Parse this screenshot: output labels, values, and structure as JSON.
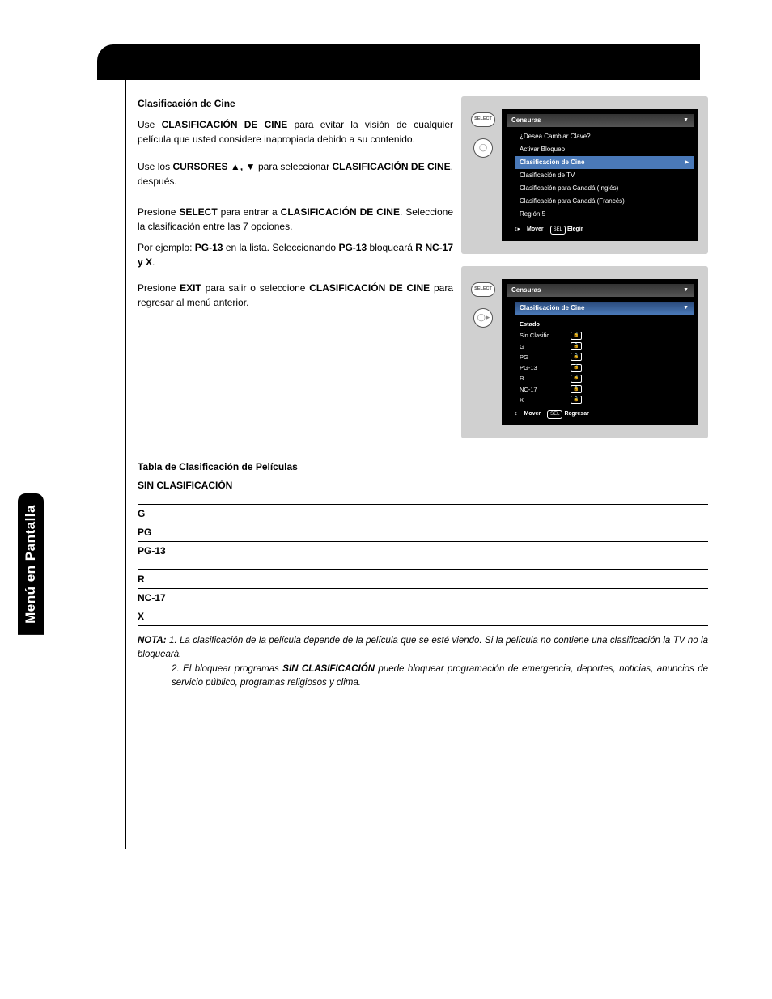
{
  "sideTab": "Menú en Pantalla",
  "heading": "Clasificación de Cine",
  "intro": {
    "pre": "Use ",
    "bold1": "CLASIFICACIÓN DE CINE",
    "post1": " para evitar la visión de cualquier película que usted considere inapropiada debido a su contenido."
  },
  "step1": {
    "pre": "Use los ",
    "cursors": "CURSORES",
    "arrows": " ▲, ▼ ",
    "mid": "para seleccionar ",
    "bold": "CLASIFICACIÓN DE CINE",
    "post": ", después."
  },
  "step2": {
    "pre": "Presione ",
    "select": "SELECT",
    "mid": " para entrar a ",
    "bold": "CLASIFICACIÓN DE CINE",
    "post": ". Seleccione la clasificación entre las 7 opciones."
  },
  "step3": {
    "pre": "Por ejemplo: ",
    "pg13_1": "PG-13",
    "mid1": " en la lista. Seleccionando ",
    "pg13_2": "PG-13",
    "mid2": " bloqueará ",
    "ratings": "R  NC-17 y X",
    "post": "."
  },
  "step4": {
    "pre": "Presione ",
    "exit": "EXIT",
    "mid": " para salir o seleccione ",
    "bold": "CLASIFICACIÓN DE CINE",
    "post": " para regresar al menú anterior."
  },
  "osd1": {
    "selectBtn": "SELECT",
    "title": "Censuras",
    "items": [
      {
        "label": "¿Desea Cambiar Clave?",
        "hl": false
      },
      {
        "label": "Activar Bloqueo",
        "hl": false
      },
      {
        "label": "Clasificación de Cine",
        "hl": true,
        "arrow": true
      },
      {
        "label": "Clasificación de TV",
        "hl": false
      },
      {
        "label": "Clasificación para Canadá (Inglés)",
        "hl": false
      },
      {
        "label": "Clasificación para Canadá (Francés)",
        "hl": false
      },
      {
        "label": "Región 5",
        "hl": false
      }
    ],
    "footer": {
      "mover": "Mover",
      "sel": "SEL",
      "elegir": "Elegir"
    }
  },
  "osd2": {
    "selectBtn": "SELECT",
    "title": "Censuras",
    "sub": "Clasificación de Cine",
    "estado": "Estado",
    "ratings": [
      "Sin Clasific.",
      "G",
      "PG",
      "PG-13",
      "R",
      "NC-17",
      "X"
    ],
    "footer": {
      "mover": "Mover",
      "sel": "SEL",
      "regresar": "Regresar"
    }
  },
  "tableTitle": "Tabla de Clasificación de Películas",
  "tableRows": [
    "SIN CLASIFICACIÓN",
    "G",
    "PG",
    "PG-13",
    "R",
    "NC-17",
    "X"
  ],
  "notes": {
    "label": "NOTA:",
    "n1a": "1. La clasificación de la película depende de la película que se esté viendo. Si la película no contiene una clasificación la TV no la bloqueará.",
    "n2a": "2. El bloquear programas ",
    "n2b": "SIN CLASIFICACIÓN",
    "n2c": " puede bloquear programación de emergencia, deportes, noticias, anuncios de servicio público, programas religiosos y clima."
  }
}
